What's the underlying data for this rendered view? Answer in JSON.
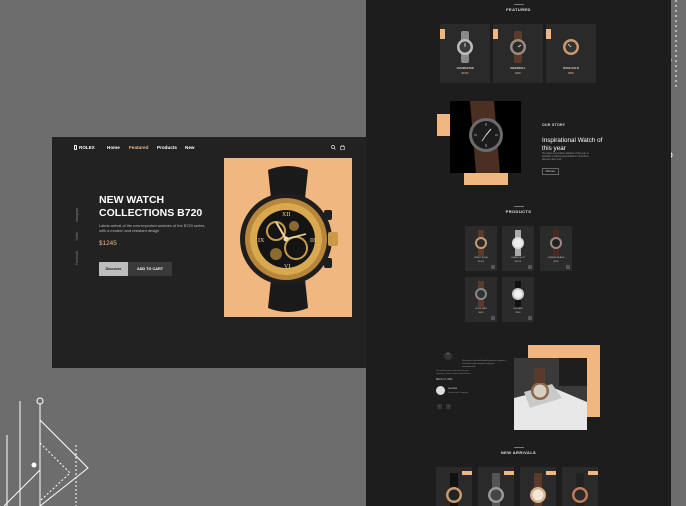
{
  "colors": {
    "accent": "#f1b781",
    "page_bg": "#222222",
    "canvas_bg": "#6d6d6d",
    "long_bg": "#1d1d1d"
  },
  "nav": {
    "logo": "ROLEX",
    "links": [
      "Home",
      "Featured",
      "Products",
      "New"
    ],
    "active": "Featured",
    "icons": [
      "search-icon",
      "bag-icon"
    ]
  },
  "social": [
    "Instagram",
    "Twitter",
    "Facebook"
  ],
  "hero": {
    "title_line1": "NEW WATCH",
    "title_line2": "COLLECTIONS B720",
    "description": "Latest arrival of the new imported watches of the B720 series, with a modern and resistant design",
    "price": "$1245",
    "discover_label": "Discover",
    "cart_label": "ADD TO CART"
  },
  "featured": {
    "heading": "FEATURED",
    "items": [
      {
        "name": "JAZZMASTER",
        "price": "$1150"
      },
      {
        "name": "INGERSOLL",
        "price": "$250"
      },
      {
        "name": "ROSE GOLD",
        "price": "$890"
      }
    ]
  },
  "story": {
    "heading": "OUR STORY",
    "title": "Inspirational Watch of this year",
    "text": "The latest and modern watches of this year, is available in various presentations in this store, discover them now.",
    "button": "Discover"
  },
  "products": {
    "heading": "PRODUCTS",
    "items": [
      {
        "name": "SPIRIT ROSE",
        "price": "$1500"
      },
      {
        "name": "KHAKI PILOT",
        "price": "$1250"
      },
      {
        "name": "JUBILEE BLACK",
        "price": "$750"
      },
      {
        "name": "FOSIL ME3",
        "price": "$650"
      },
      {
        "name": "DUCHEN",
        "price": "$950"
      }
    ]
  },
  "testimonial": {
    "quote_icon": "quote-icon",
    "quote": "Write your best testimonial about our product and share with everyone why you recommend it.",
    "text_left": "The website you create will help your company to have a good web presence.",
    "date": "March 27, 2021",
    "name": "Lee Doe",
    "role": "Director of a Company"
  },
  "arrivals": {
    "heading": "NEW ARRIVALS"
  }
}
